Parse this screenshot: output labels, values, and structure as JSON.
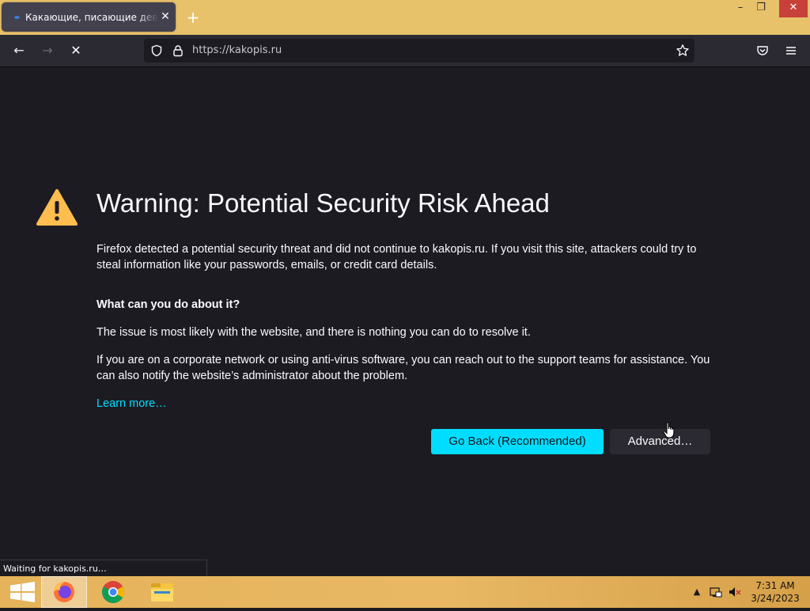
{
  "browser": {
    "tab": {
      "title": "Какающие, писающие девушки",
      "close": "✕"
    },
    "new_tab": "+",
    "window_controls": {
      "minimize": "–",
      "maximize": "❐",
      "close": "✕"
    },
    "url": "https://kakopis.ru",
    "nav": {
      "back": "←",
      "forward": "→",
      "reload_stop": "✕"
    }
  },
  "page": {
    "title": "Warning: Potential Security Risk Ahead",
    "description": "Firefox detected a potential security threat and did not continue to kakopis.ru. If you visit this site, attackers could try to steal information like your passwords, emails, or credit card details.",
    "subheading": "What can you do about it?",
    "paragraph1": "The issue is most likely with the website, and there is nothing you can do to resolve it.",
    "paragraph2": "If you are on a corporate network or using anti-virus software, you can reach out to the support teams for assistance. You can also notify the website’s administrator about the problem.",
    "learn_more": "Learn more…",
    "go_back_button": "Go Back (Recommended)",
    "advanced_button": "Advanced…"
  },
  "status_bar": "Waiting for kakopis.ru…",
  "taskbar": {
    "apps": [
      "start-icon",
      "firefox-icon",
      "chrome-icon",
      "file-explorer-icon"
    ],
    "tray": {
      "expand": "▲"
    },
    "clock": {
      "time": "7:31 AM",
      "date": "3/24/2023"
    }
  },
  "colors": {
    "page_bg": "#1c1b22",
    "accent": "#00ddff",
    "warning": "#ffbd4f",
    "titlebar": "#e8c16b"
  }
}
